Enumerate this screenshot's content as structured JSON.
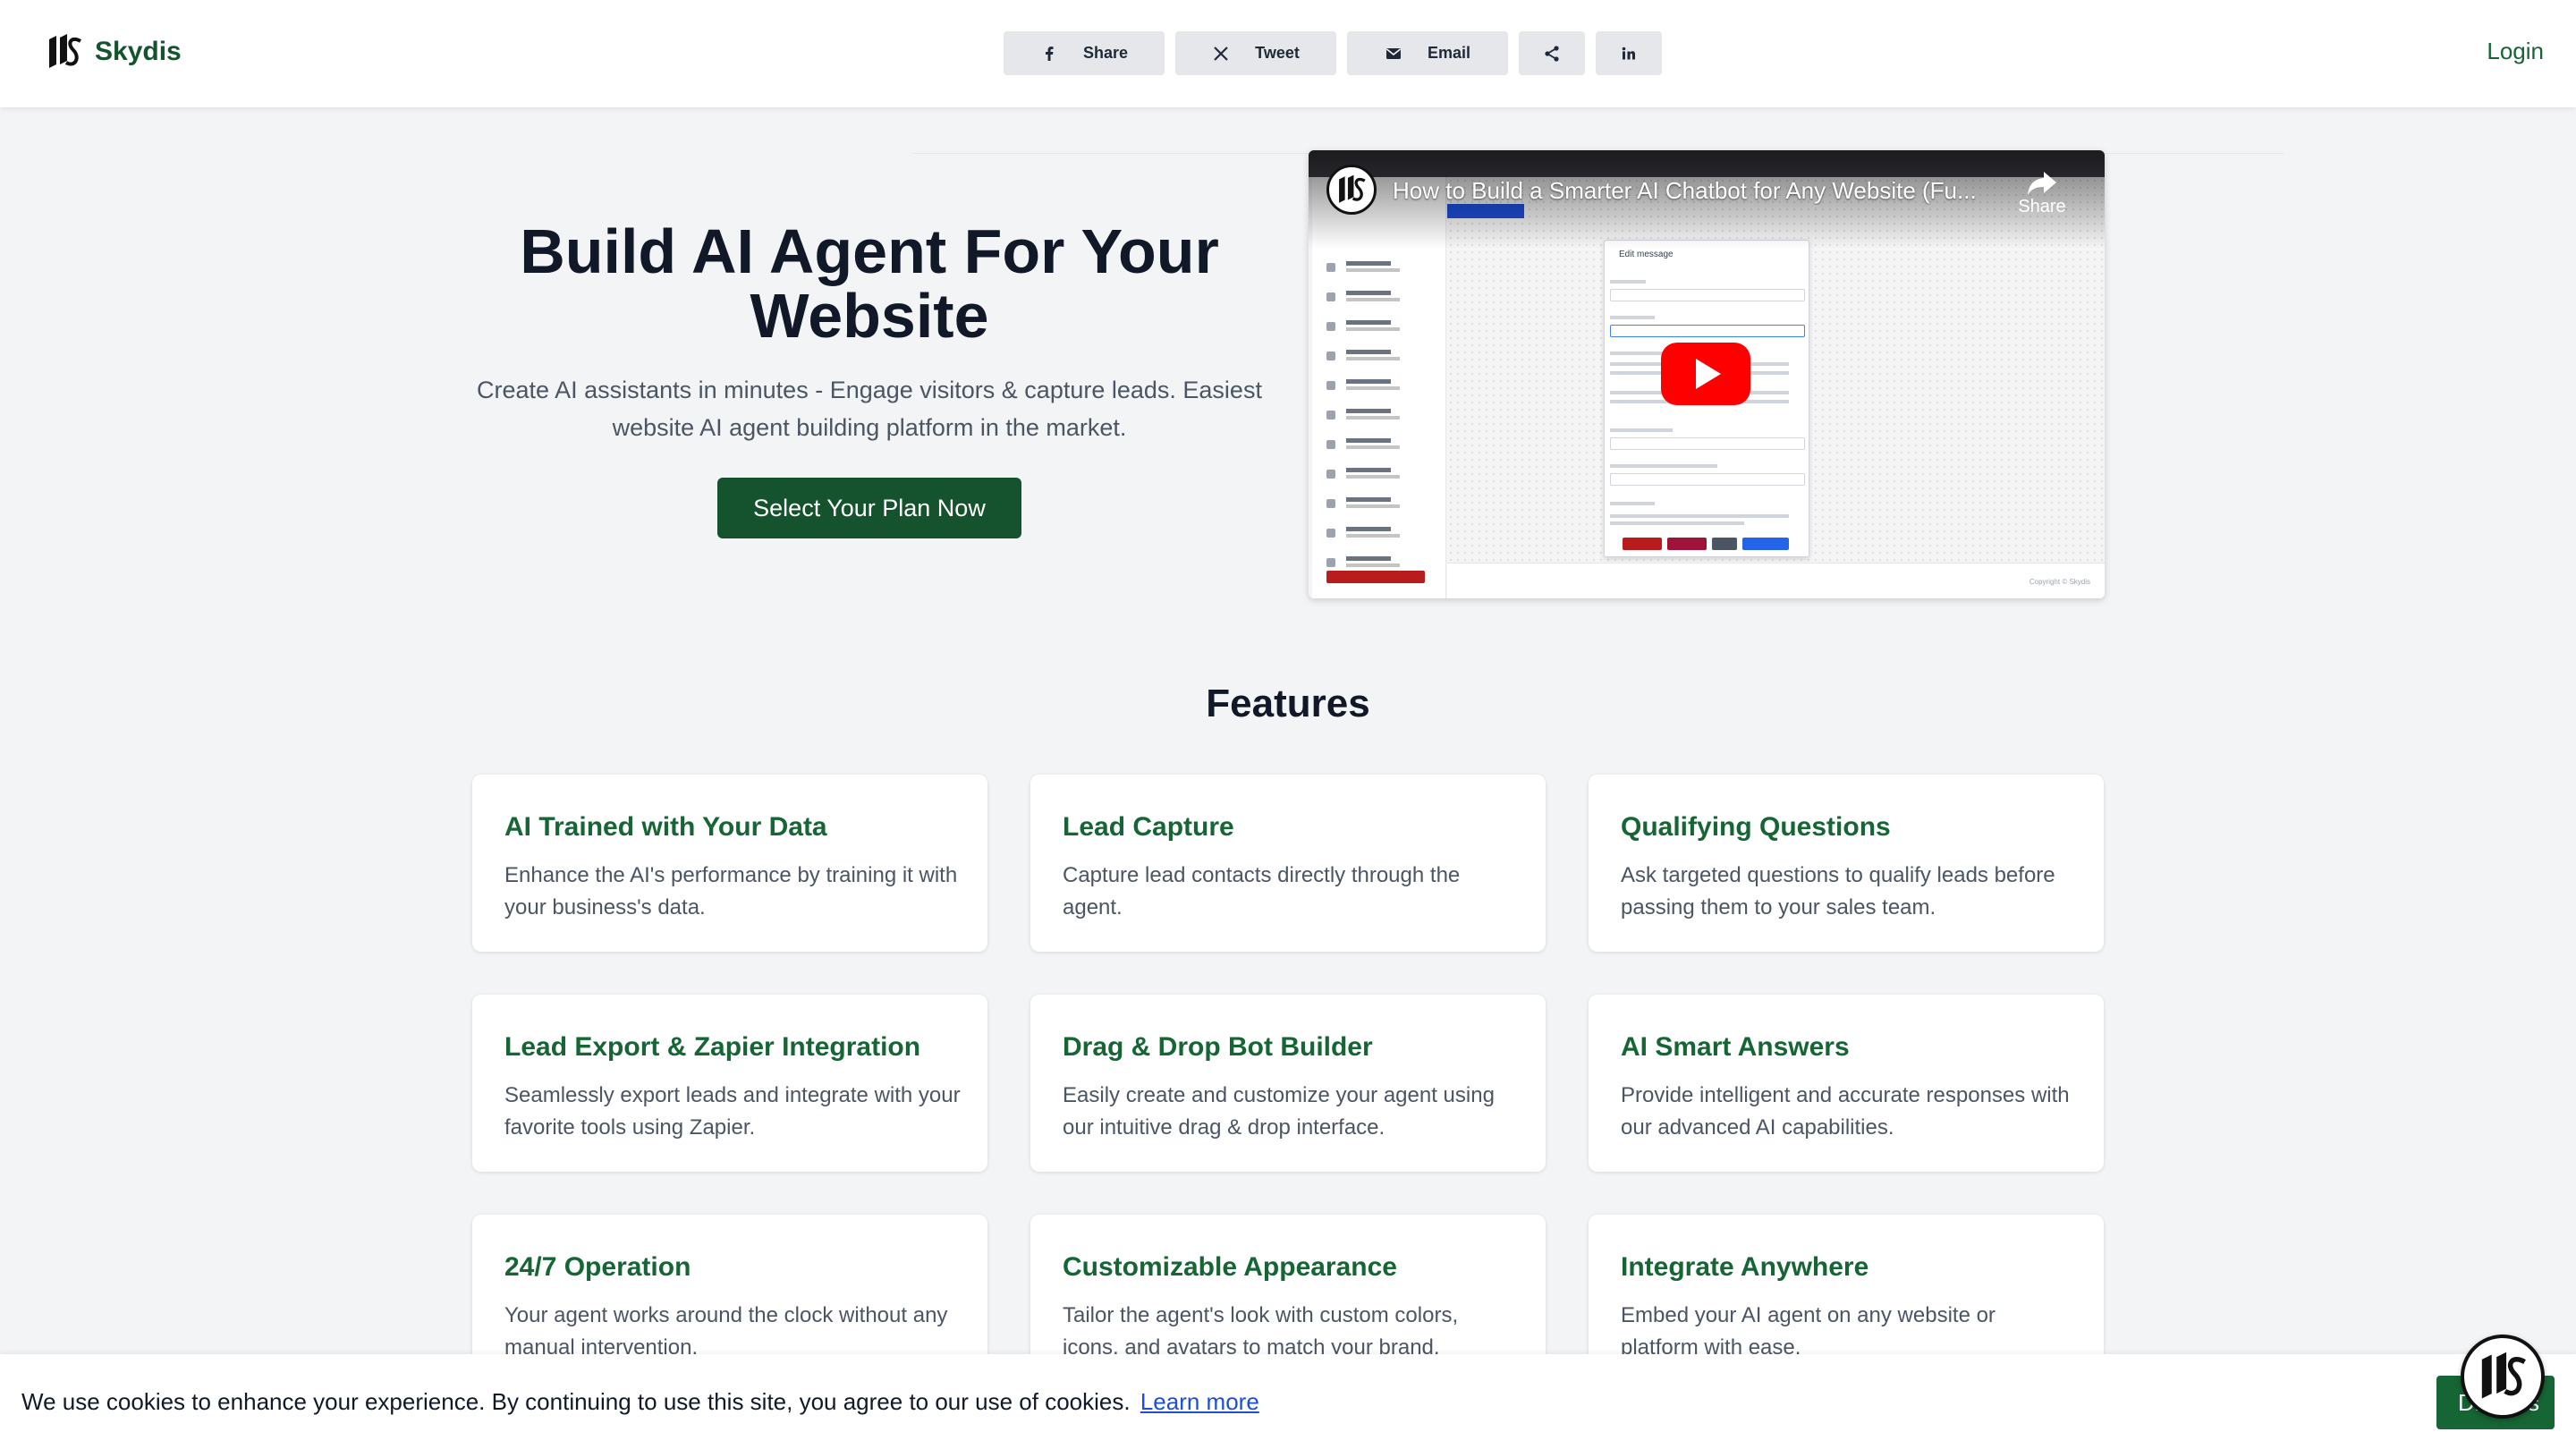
{
  "header": {
    "brand": "Skydis",
    "login": "Login",
    "share_buttons": [
      {
        "label": "Share",
        "icon": "facebook-icon"
      },
      {
        "label": "Tweet",
        "icon": "x-icon"
      },
      {
        "label": "Email",
        "icon": "email-icon"
      },
      {
        "label": "",
        "icon": "share-icon"
      },
      {
        "label": "",
        "icon": "linkedin-icon"
      }
    ]
  },
  "hero": {
    "title": "Build AI Agent For Your Website",
    "subtitle": "Create AI assistants in minutes - Engage visitors & capture leads. Easiest website AI agent building platform in the market.",
    "cta": "Select Your Plan Now"
  },
  "video": {
    "title": "How to Build a Smarter AI Chatbot for Any Website (Fu...",
    "share_label": "Share",
    "brand_label": "Skydis",
    "dialog_title": "Edit message",
    "copyright": "Copyright © Skydis"
  },
  "features": {
    "heading": "Features",
    "items": [
      {
        "title": "AI Trained with Your Data",
        "desc": "Enhance the AI's performance by training it with your business's data."
      },
      {
        "title": "Lead Capture",
        "desc": "Capture lead contacts directly through the agent."
      },
      {
        "title": "Qualifying Questions",
        "desc": "Ask targeted questions to qualify leads before passing them to your sales team."
      },
      {
        "title": "Lead Export & Zapier Integration",
        "desc": "Seamlessly export leads and integrate with your favorite tools using Zapier."
      },
      {
        "title": "Drag & Drop Bot Builder",
        "desc": "Easily create and customize your agent using our intuitive drag & drop interface."
      },
      {
        "title": "AI Smart Answers",
        "desc": "Provide intelligent and accurate responses with our advanced AI capabilities."
      },
      {
        "title": "24/7 Operation",
        "desc": "Your agent works around the clock without any manual intervention."
      },
      {
        "title": "Customizable Appearance",
        "desc": "Tailor the agent's look with custom colors, icons, and avatars to match your brand."
      },
      {
        "title": "Integrate Anywhere",
        "desc": "Embed your AI agent on any website or platform with ease."
      }
    ]
  },
  "cookie": {
    "text": "We use cookies to enhance your experience. By continuing to use this site, you agree to our use of cookies.",
    "link": "Learn more",
    "button": "Dismiss"
  },
  "colors": {
    "brand_green": "#14532d",
    "accent_green": "#166534",
    "background": "#f3f4f6",
    "youtube_red": "#ff0000"
  }
}
